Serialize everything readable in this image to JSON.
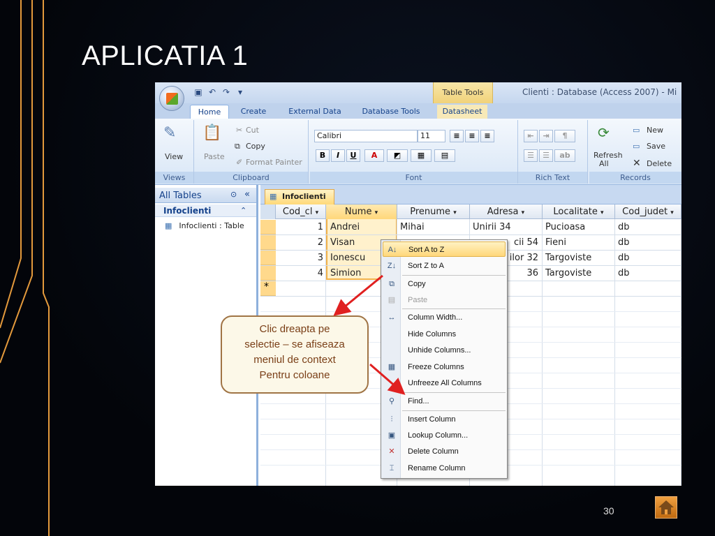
{
  "slide": {
    "title": "APLICATIA 1",
    "page_number": "30",
    "home_icon": "home-icon"
  },
  "app": {
    "window_title": "Clienti : Database (Access 2007) - Mi",
    "context_tab_group": "Table Tools",
    "tabs": [
      "Home",
      "Create",
      "External Data",
      "Database Tools",
      "Datasheet"
    ],
    "active_tab": "Home",
    "ribbon": {
      "views": {
        "label": "Views",
        "view_button": "View"
      },
      "clipboard": {
        "label": "Clipboard",
        "paste": "Paste",
        "cut": "Cut",
        "copy": "Copy",
        "format_painter": "Format Painter"
      },
      "font": {
        "label": "Font",
        "font_name": "Calibri",
        "font_size": "11",
        "bold": "B",
        "italic": "I",
        "underline": "U",
        "font_color": "A"
      },
      "rich_text": {
        "label": "Rich Text"
      },
      "records": {
        "label": "Records",
        "refresh": "Refresh",
        "refresh_all": "All",
        "new": "New",
        "save": "Save",
        "delete": "Delete"
      }
    },
    "nav_pane": {
      "header": "All Tables",
      "group": "Infoclienti",
      "item": "Infoclienti : Table"
    },
    "document_tab": "Infoclienti",
    "table": {
      "columns": [
        "Cod_cl",
        "Nume",
        "Prenume",
        "Adresa",
        "Localitate",
        "Cod_judet"
      ],
      "rows": [
        {
          "cod": "1",
          "nume": "Andrei",
          "prenume": "Mihai",
          "adresa": "Unirii 34",
          "localitate": "Pucioasa",
          "judet": "db"
        },
        {
          "cod": "2",
          "nume": "Visan",
          "prenume": "",
          "adresa": "cii 54",
          "localitate": "Fieni",
          "judet": "db"
        },
        {
          "cod": "3",
          "nume": "Ionescu",
          "prenume": "",
          "adresa": "ilor 32",
          "localitate": "Targoviste",
          "judet": "db"
        },
        {
          "cod": "4",
          "nume": "Simion",
          "prenume": "",
          "adresa": "36",
          "localitate": "Targoviste",
          "judet": "db"
        }
      ],
      "new_row_marker": "*"
    },
    "context_menu": [
      "Sort A to Z",
      "Sort Z to A",
      "Copy",
      "Paste",
      "Column Width...",
      "Hide Columns",
      "Unhide Columns...",
      "Freeze Columns",
      "Unfreeze All Columns",
      "Find...",
      "Insert Column",
      "Lookup Column...",
      "Delete Column",
      "Rename Column"
    ]
  },
  "callout": {
    "line1": "Clic dreapta pe",
    "line2": "selectie – se afiseaza",
    "line3": "meniul de context",
    "line4": "Pentru coloane"
  },
  "colors": {
    "background": "#04060c",
    "deco_lines": "#e49a3c",
    "callout_border": "#a07445",
    "callout_text": "#7a3f17",
    "arrow": "#e02020",
    "selection": "#f2b24a"
  }
}
